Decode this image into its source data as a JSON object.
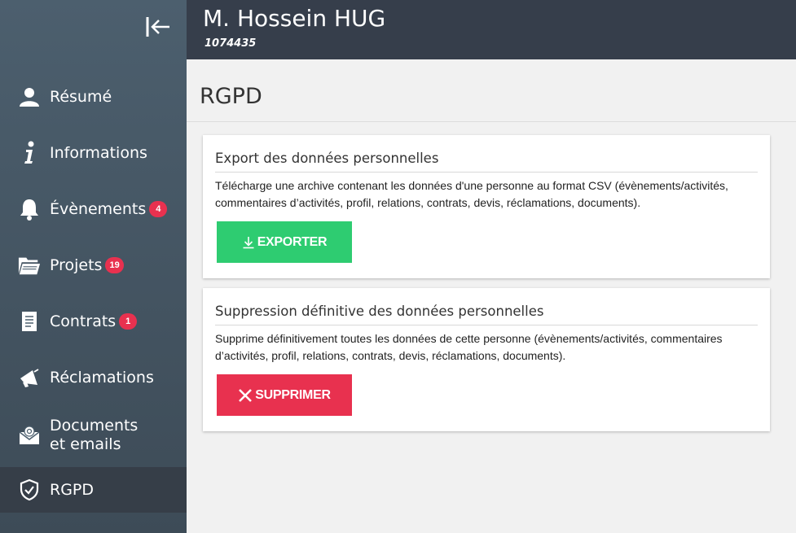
{
  "header": {
    "name": "M. Hossein HUG",
    "id": "1074435"
  },
  "sidebar": {
    "items": [
      {
        "label": "Résumé",
        "icon": "person-icon",
        "badge": null
      },
      {
        "label": "Informations",
        "icon": "info-icon",
        "badge": null
      },
      {
        "label": "Évènements",
        "icon": "bell-icon",
        "badge": "4"
      },
      {
        "label": "Projets",
        "icon": "folder-icon",
        "badge": "19"
      },
      {
        "label": "Contrats",
        "icon": "document-icon",
        "badge": "1"
      },
      {
        "label": "Réclamations",
        "icon": "megaphone-icon",
        "badge": null
      },
      {
        "label_line1": "Documents",
        "label_line2": "et emails",
        "icon": "envelope-icon",
        "badge": null
      },
      {
        "label": "RGPD",
        "icon": "shield-check-icon",
        "badge": null,
        "active": true
      }
    ]
  },
  "main": {
    "title": "RGPD",
    "export": {
      "title": "Export des données personnelles",
      "description": "Télécharge une archive contenant les données d'une personne au format CSV (évènements/activités, commentaires d’activités, profil, relations, contrats, devis, réclamations, documents).",
      "button": "EXPORTER"
    },
    "delete": {
      "title": "Suppression définitive des données personnelles",
      "description": "Supprime définitivement toutes les données de cette personne (évènements/activités, commentaires d’activités, profil, relations, contrats, devis, réclamations, documents).",
      "button": "SUPPRIMER"
    }
  },
  "colors": {
    "sidebar_top": "#4c5f6e",
    "sidebar_bottom": "#3d4b57",
    "header": "#363e4b",
    "export_green": "#2ecc71",
    "delete_red": "#e8314f",
    "badge_red": "#e8314f"
  }
}
